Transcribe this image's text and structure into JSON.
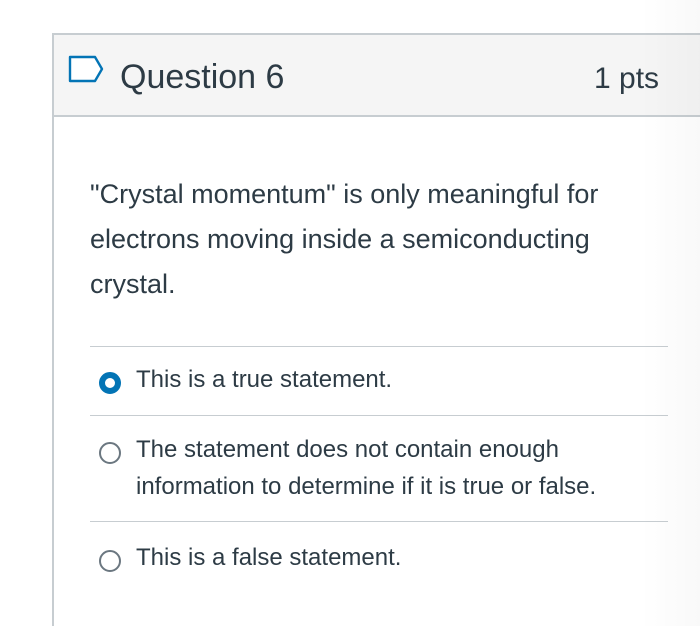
{
  "question": {
    "flag_icon": "flag-outline-icon",
    "title": "Question 6",
    "points": "1 pts",
    "text": "\"Crystal momentum\" is only meaningful for electrons moving inside a semiconducting crystal."
  },
  "answers": [
    {
      "label": "This is a true statement.",
      "selected": true
    },
    {
      "label": "The statement does not contain enough information to determine if it is true or false.",
      "selected": false
    },
    {
      "label": "This is a false statement.",
      "selected": false
    }
  ],
  "colors": {
    "accent": "#0374b5",
    "header_bg": "#f5f5f5",
    "border": "#c7cdd1",
    "text": "#2d3b45"
  }
}
